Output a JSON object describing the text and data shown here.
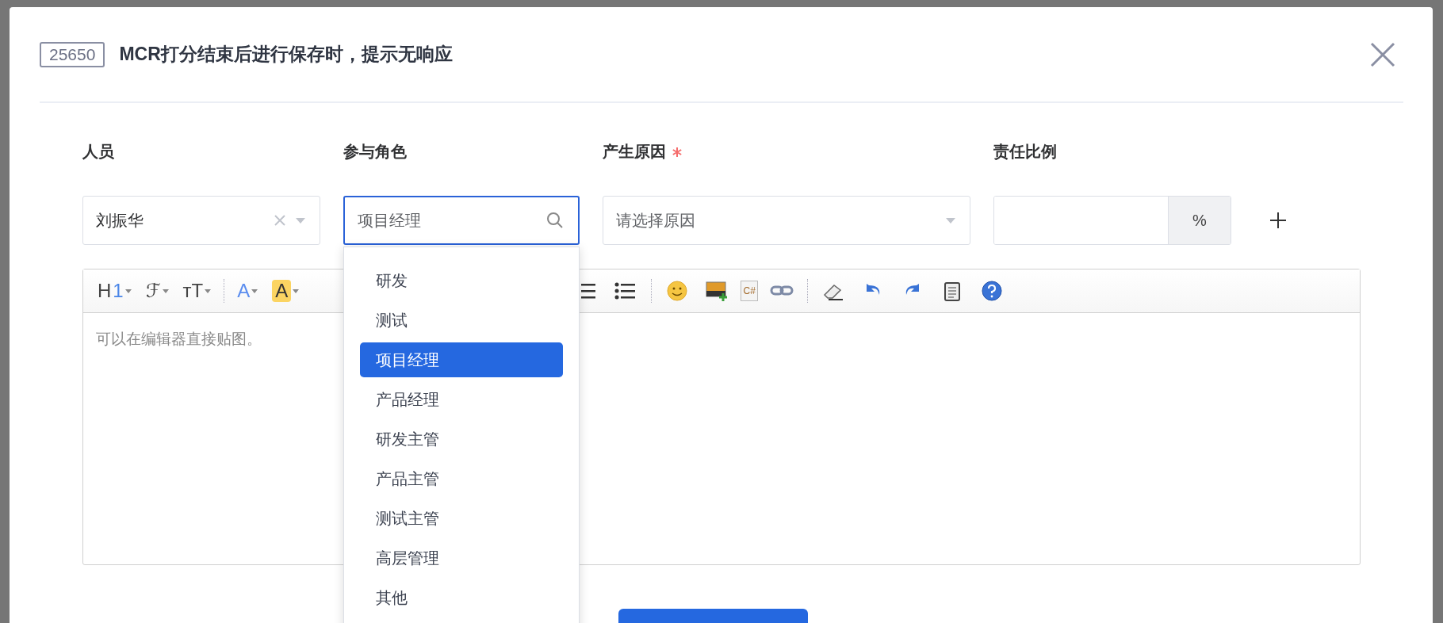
{
  "dialog": {
    "badge": "25650",
    "title": "MCR打分结束后进行保存时，提示无响应"
  },
  "form": {
    "person": {
      "label": "人员",
      "value": "刘振华"
    },
    "role": {
      "label": "参与角色",
      "value": "项目经理",
      "focused": true
    },
    "reason": {
      "label": "产生原因",
      "required": true,
      "placeholder": "请选择原因"
    },
    "ratio": {
      "label": "责任比例",
      "unit": "%"
    }
  },
  "role_options": [
    {
      "label": "研发",
      "selected": false
    },
    {
      "label": "测试",
      "selected": false
    },
    {
      "label": "项目经理",
      "selected": true
    },
    {
      "label": "产品经理",
      "selected": false
    },
    {
      "label": "研发主管",
      "selected": false
    },
    {
      "label": "产品主管",
      "selected": false
    },
    {
      "label": "测试主管",
      "selected": false
    },
    {
      "label": "高层管理",
      "selected": false
    },
    {
      "label": "其他",
      "selected": false
    }
  ],
  "toolbar": [
    {
      "kind": "heading",
      "label": "H",
      "accent": "1"
    },
    {
      "kind": "font",
      "label": "ℱ"
    },
    {
      "kind": "size",
      "label": "ᴛT"
    },
    {
      "kind": "sep"
    },
    {
      "kind": "color",
      "label": "A"
    },
    {
      "kind": "highlight",
      "label": "A"
    },
    {
      "kind": "gap"
    },
    {
      "kind": "ol"
    },
    {
      "kind": "ul"
    },
    {
      "kind": "sep"
    },
    {
      "kind": "emoji"
    },
    {
      "kind": "image"
    },
    {
      "kind": "code",
      "label": "C#"
    },
    {
      "kind": "link"
    },
    {
      "kind": "sep"
    },
    {
      "kind": "eraser"
    },
    {
      "kind": "undo"
    },
    {
      "kind": "redo"
    },
    {
      "kind": "paste"
    },
    {
      "kind": "help"
    }
  ],
  "editor": {
    "placeholder": "可以在编辑器直接贴图。"
  }
}
